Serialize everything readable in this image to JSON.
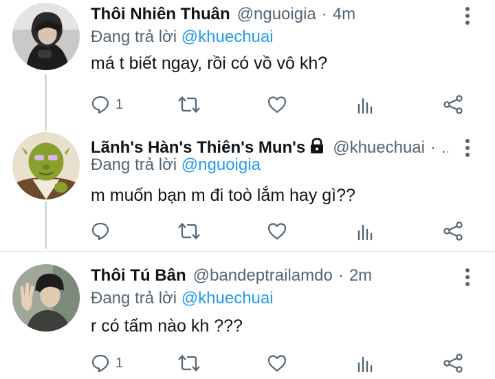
{
  "colors": {
    "link": "#1d9bf0",
    "secondary": "#536471",
    "thread_line": "#cfd9de"
  },
  "tweets": [
    {
      "name": "Thôi Nhiên Thuân",
      "handle": "@nguoigia",
      "separator": "·",
      "time": "4m",
      "reply_prefix": "Đang trả lời",
      "reply_to": "@khuechuai",
      "text": "má t biết ngay, rồi có vồ vô kh?",
      "reply_count": "1",
      "avatar": "dark-haired-person-avatar"
    },
    {
      "name": "Lãnh's Hàn's Thiên's Mun's",
      "locked": true,
      "handle": "@khuechuai",
      "separator": "·",
      "time": "...",
      "reply_prefix": "Đang trả lời",
      "reply_to": "@nguoigia",
      "text": "m muốn bạn m đi toò lắm hay gì??",
      "reply_count": "",
      "avatar": "green-ogre-avatar"
    },
    {
      "name": "Thôi Tú Bân",
      "handle": "@bandeptrailamdo",
      "separator": "·",
      "time": "2m",
      "reply_prefix": "Đang trả lời",
      "reply_to": "@khuechuai",
      "text": "r có tấm nào kh ???",
      "reply_count": "1",
      "avatar": "waving-person-avatar"
    }
  ],
  "icons": {
    "reply": "reply-icon",
    "retweet": "retweet-icon",
    "like": "like-icon",
    "analytics": "analytics-icon",
    "share": "share-icon",
    "more": "more-options-icon",
    "lock": "lock-icon"
  }
}
